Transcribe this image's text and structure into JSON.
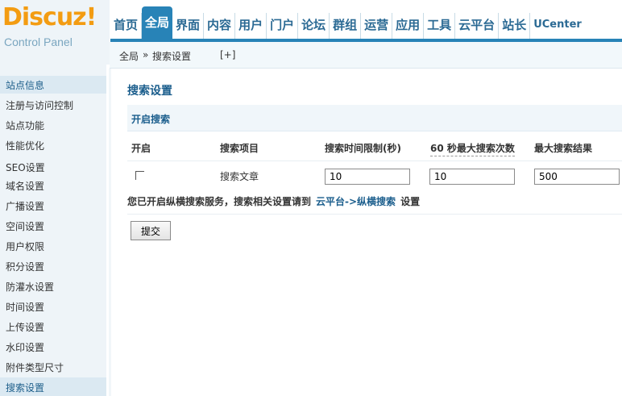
{
  "logo": {
    "main": "Discuz!",
    "sub": "Control Panel"
  },
  "nav": {
    "items": [
      {
        "label": "首页"
      },
      {
        "label": "全局",
        "active": true
      },
      {
        "label": "界面"
      },
      {
        "label": "内容"
      },
      {
        "label": "用户"
      },
      {
        "label": "门户"
      },
      {
        "label": "论坛"
      },
      {
        "label": "群组"
      },
      {
        "label": "运营"
      },
      {
        "label": "应用"
      },
      {
        "label": "工具"
      },
      {
        "label": "云平台"
      },
      {
        "label": "站长"
      },
      {
        "label": "UCenter"
      }
    ]
  },
  "breadcrumb": {
    "root": "全局",
    "sep": "»",
    "current": "搜索设置",
    "add": "[+]"
  },
  "sidebar": {
    "items": [
      {
        "label": "站点信息"
      },
      {
        "label": "注册与访问控制"
      },
      {
        "label": "站点功能"
      },
      {
        "label": "性能优化"
      },
      {
        "label": "SEO设置"
      },
      {
        "label": "域名设置"
      },
      {
        "label": "广播设置"
      },
      {
        "label": "空间设置"
      },
      {
        "label": "用户权限"
      },
      {
        "label": "积分设置"
      },
      {
        "label": "防灌水设置"
      },
      {
        "label": "时间设置"
      },
      {
        "label": "上传设置"
      },
      {
        "label": "水印设置"
      },
      {
        "label": "附件类型尺寸"
      },
      {
        "label": "搜索设置"
      }
    ]
  },
  "main": {
    "title": "搜索设置",
    "section": "开启搜索",
    "headers": {
      "enable": "开启",
      "item": "搜索项目",
      "time_limit": "搜索时间限制(秒)",
      "max_count": "60 秒最大搜索次数",
      "max_results": "最大搜索结果"
    },
    "row": {
      "item": "搜索文章",
      "time_limit": "10",
      "max_count": "10",
      "max_results": "500"
    },
    "note": {
      "text": "您已开启纵横搜索服务，搜索相关设置请到",
      "link": "云平台->纵横搜索",
      "suffix": "设置"
    },
    "submit": "提交"
  }
}
